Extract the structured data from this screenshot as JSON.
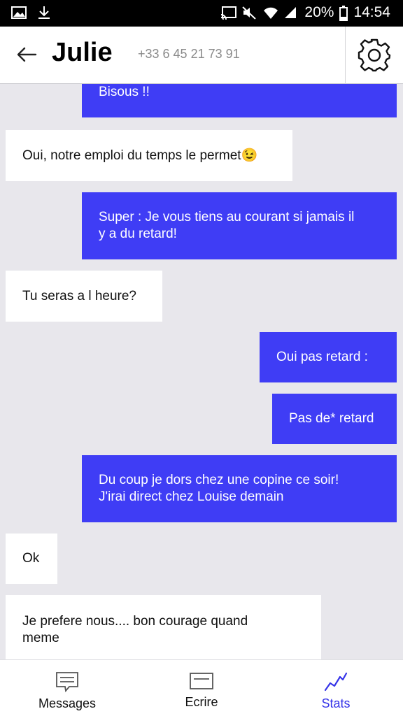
{
  "status_bar": {
    "battery": "20%",
    "time": "14:54"
  },
  "header": {
    "contact_name": "Julie",
    "phone": "+33 6 45 21 73 91"
  },
  "messages": [
    {
      "direction": "out",
      "lines": [
        "Bisous !!"
      ]
    },
    {
      "direction": "in",
      "lines": [
        "Oui, notre emploi du temps le permet😉"
      ]
    },
    {
      "direction": "out",
      "lines": [
        "Super : Je vous tiens au courant si jamais il",
        "y a du retard!"
      ]
    },
    {
      "direction": "in",
      "lines": [
        "Tu seras a l heure?"
      ]
    },
    {
      "direction": "out",
      "lines": [
        "Oui pas retard :"
      ]
    },
    {
      "direction": "out",
      "lines": [
        "Pas de* retard"
      ]
    },
    {
      "direction": "out",
      "lines": [
        "Du coup je dors chez une copine ce soir!",
        "J'irai direct chez Louise demain"
      ]
    },
    {
      "direction": "in",
      "lines": [
        "Ok"
      ]
    },
    {
      "direction": "in",
      "lines": [
        "Je prefere nous.... bon courage quand",
        "meme"
      ]
    }
  ],
  "bottom_nav": {
    "items": [
      {
        "label": "Messages",
        "icon": "messages-icon",
        "active": false
      },
      {
        "label": "Ecrire",
        "icon": "compose-icon",
        "active": false
      },
      {
        "label": "Stats",
        "icon": "stats-icon",
        "active": true
      }
    ]
  },
  "colors": {
    "outgoing_bubble": "#3f3df5",
    "incoming_bubble": "#ffffff",
    "chat_background": "#e8e7ec",
    "active_nav": "#3533e8"
  }
}
